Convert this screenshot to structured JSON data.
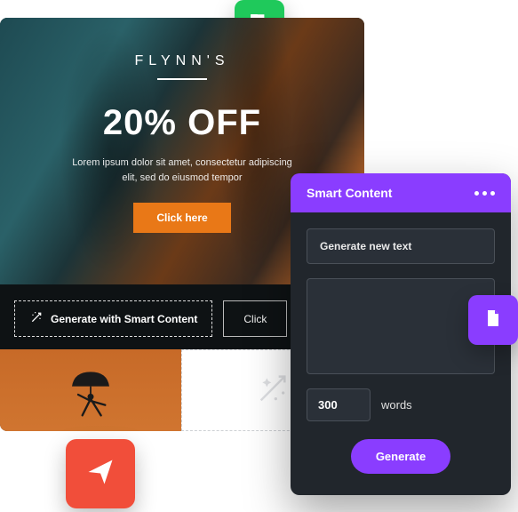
{
  "preview": {
    "brand": "FLYNN'S",
    "headline": "20% OFF",
    "body": "Lorem ipsum dolor sit amet, consectetur adipiscing elit, sed do eiusmod tempor",
    "cta_label": "Click here",
    "toolbar": {
      "smart_label": "Generate with Smart Content",
      "ghost_label": "Click"
    }
  },
  "panel": {
    "title": "Smart Content",
    "prompt_placeholder": "Generate new text",
    "word_count": "300",
    "word_unit": "words",
    "generate_label": "Generate"
  },
  "icons": {
    "green_app": "flipboard-icon",
    "purple_app": "document-icon",
    "red_app": "send-icon"
  }
}
